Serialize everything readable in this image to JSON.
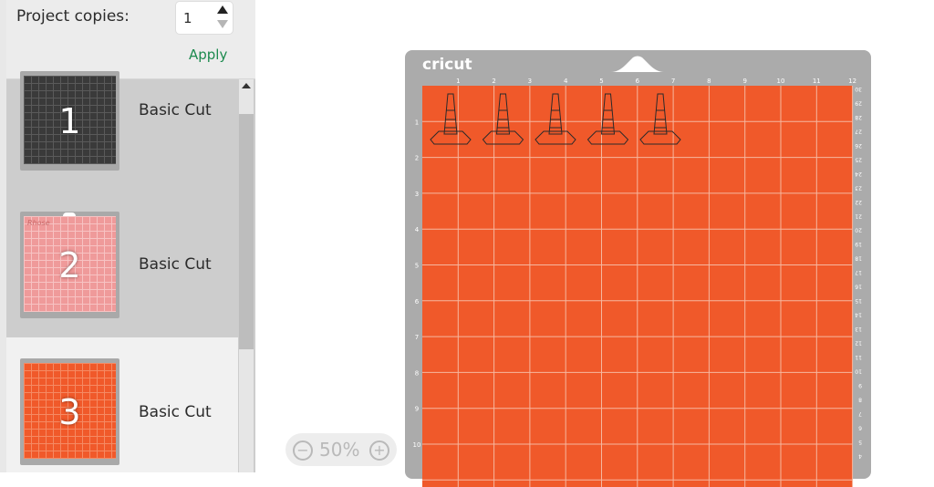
{
  "copies": {
    "label": "Project copies:",
    "value": "1",
    "apply": "Apply"
  },
  "mats": [
    {
      "number": "1",
      "label": "Basic Cut",
      "color": "#3a3a3a",
      "grid": "#5a5a5a"
    },
    {
      "number": "2",
      "label": "Basic Cut",
      "color": "#ef9a9a",
      "grid": "#f7c3c3",
      "mark": "Rhose"
    },
    {
      "number": "3",
      "label": "Basic Cut",
      "color": "#f0592a",
      "grid": "#f58a63"
    }
  ],
  "zoom": {
    "minus": "−",
    "value": "50%",
    "plus": "+"
  },
  "mat": {
    "brand": "cricut",
    "color": "#f0592a",
    "top_ticks": [
      "1",
      "2",
      "3",
      "4",
      "5",
      "6",
      "7",
      "8",
      "9",
      "10",
      "11",
      "12"
    ],
    "left_ticks": [
      "1",
      "2",
      "3",
      "4",
      "5",
      "6",
      "7",
      "8",
      "9",
      "10"
    ],
    "right_ticks": [
      "30",
      "29",
      "28",
      "27",
      "26",
      "25",
      "24",
      "23",
      "22",
      "21",
      "20",
      "19",
      "18",
      "17",
      "16",
      "15",
      "14",
      "13",
      "12",
      "11",
      "10",
      "9",
      "8",
      "7",
      "6",
      "5",
      "4"
    ],
    "cone_count": 5
  }
}
